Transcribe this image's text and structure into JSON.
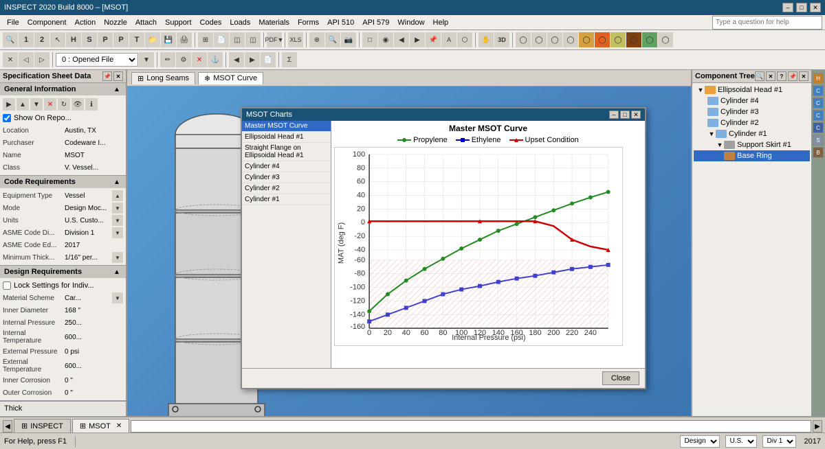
{
  "window": {
    "title": "INSPECT 2020 Build 8000 – [MSOT]",
    "help_placeholder": "Type a question for help"
  },
  "title_controls": [
    "–",
    "□",
    "✕"
  ],
  "menu": {
    "items": [
      "File",
      "Component",
      "Action",
      "Nozzle",
      "Attach",
      "Support",
      "Codes",
      "Loads",
      "Materials",
      "Forms",
      "API 510",
      "API 579",
      "Window",
      "Help"
    ]
  },
  "toolbar1": {
    "combo_value": "0 : Opened File"
  },
  "left_panel": {
    "title": "Specification Sheet Data",
    "general_info": {
      "title": "General Information",
      "show_on_report_label": "Show On Repo...",
      "location_label": "Location",
      "location_value": "Austin, TX",
      "purchaser_label": "Purchaser",
      "purchaser_value": "Codeware I...",
      "name_label": "Name",
      "name_value": "MSOT",
      "class_label": "Class",
      "class_value": "V. Vessel..."
    },
    "code_req": {
      "title": "Code Requirements",
      "equip_type_label": "Equipment Type",
      "equip_type_value": "Vessel",
      "mode_label": "Mode",
      "mode_value": "Design Moc...",
      "units_label": "Units",
      "units_value": "U.S. Custo...",
      "asme_div_label": "ASME Code Di...",
      "asme_div_value": "Division 1",
      "asme_ed_label": "ASME Code Ed...",
      "asme_ed_value": "2017",
      "min_thick_label": "Minimum Thick...",
      "min_thick_value": "1/16\" per..."
    },
    "design_req": {
      "title": "Design Requirements",
      "lock_label": "Lock Settings for Indiv...",
      "mat_scheme_label": "Material Scheme",
      "mat_scheme_value": "Car...",
      "inner_dia_label": "Inner Diameter",
      "inner_dia_value": "168 \"",
      "int_pressure_label": "Internal Pressure",
      "int_pressure_value": "250...",
      "int_temp_label": "Internal Temperature",
      "int_temp_value": "600...",
      "ext_pressure_label": "External Pressure",
      "ext_pressure_value": "0 psi",
      "ext_temp_label": "External Temperature",
      "ext_temp_value": "600...",
      "inner_cor_label": "Inner Corrosion",
      "inner_cor_value": "0 \"",
      "outer_cor_label": "Outer Corrosion",
      "outer_cor_value": "0 \""
    },
    "thick_label": "Thick"
  },
  "viewport": {
    "tabs": [
      {
        "label": "Long Seams",
        "icon": "⊞",
        "active": false
      },
      {
        "label": "MSOT Curve",
        "icon": "❄",
        "active": true
      }
    ]
  },
  "component_tree": {
    "title": "Component Tree",
    "items": [
      {
        "label": "Ellipsoidal Head #1",
        "indent": 0,
        "icon": "head",
        "expanded": true
      },
      {
        "label": "Cylinder #4",
        "indent": 1,
        "icon": "cyl"
      },
      {
        "label": "Cylinder #3",
        "indent": 1,
        "icon": "cyl"
      },
      {
        "label": "Cylinder #2",
        "indent": 1,
        "icon": "cyl"
      },
      {
        "label": "Cylinder #1",
        "indent": 1,
        "icon": "cyl",
        "expanded": true
      },
      {
        "label": "Support Skirt #1",
        "indent": 2,
        "icon": "support",
        "expanded": true
      },
      {
        "label": "Base Ring",
        "indent": 3,
        "icon": "ring"
      }
    ]
  },
  "msot_dialog": {
    "title": "MSOT Charts",
    "chart_items": [
      {
        "label": "Master MSOT Curve",
        "selected": true
      },
      {
        "label": "Ellipsoidal Head #1"
      },
      {
        "label": "Straight Flange on Ellipsoidal Head #1"
      },
      {
        "label": "Cylinder #4"
      },
      {
        "label": "Cylinder #3"
      },
      {
        "label": "Cylinder #2"
      },
      {
        "label": "Cylinder #1"
      }
    ],
    "chart_title": "Master MSOT Curve",
    "legend": [
      {
        "label": "Propylene",
        "color": "#228B22"
      },
      {
        "label": "Ethylene",
        "color": "#0000CD"
      },
      {
        "label": "Upset Condition",
        "color": "#CC0000"
      }
    ],
    "x_axis": "Internal Pressure (psi)",
    "y_axis": "MAT (deg F)",
    "x_ticks": [
      "0",
      "20",
      "40",
      "60",
      "80",
      "100",
      "120",
      "140",
      "160",
      "180",
      "200",
      "220",
      "240"
    ],
    "y_ticks": [
      "100",
      "80",
      "60",
      "40",
      "20",
      "0",
      "-20",
      "-40",
      "-60",
      "-80",
      "-100",
      "-120",
      "-140",
      "-160"
    ],
    "close_btn": "Close"
  },
  "status_bar": {
    "help_text": "For Help, press F1",
    "mode": "Design",
    "units": "U.S.",
    "div": "Div 1",
    "year": "2017"
  },
  "bottom_tabs": [
    {
      "label": "INSPECT",
      "active": false
    },
    {
      "label": "MSOT",
      "active": true
    }
  ]
}
